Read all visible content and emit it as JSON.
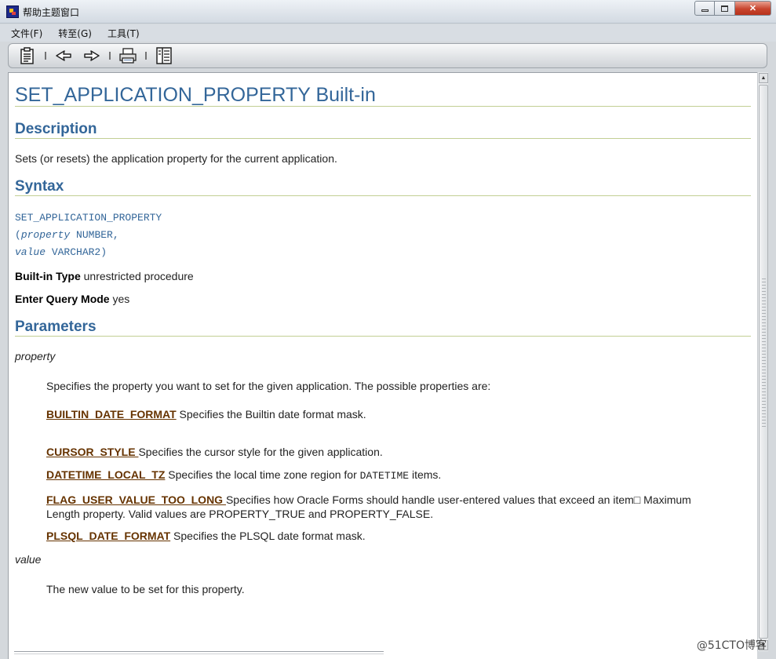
{
  "window": {
    "title": "帮助主题窗口"
  },
  "menu": [
    "文件(F)",
    "转至(G)",
    "工具(T)"
  ],
  "toolbar": {
    "icons": [
      "contents-icon",
      "back-icon",
      "forward-icon",
      "print-icon",
      "index-icon"
    ]
  },
  "doc": {
    "title": "SET_APPLICATION_PROPERTY Built-in",
    "description_heading": "Description",
    "description_text": "Sets (or resets) the application property for the current application.",
    "syntax_heading": "Syntax",
    "syntax_line1": "SET_APPLICATION_PROPERTY",
    "syntax_line2_paren": "(",
    "syntax_line2_param": "property",
    "syntax_line2_type": " NUMBER,",
    "syntax_line3_param": "value",
    "syntax_line3_type": " VARCHAR2)",
    "builtin_type_label": "Built-in Type",
    "builtin_type_value": " unrestricted procedure",
    "enter_query_label": "Enter Query Mode",
    "enter_query_value": " yes",
    "parameters_heading": "Parameters",
    "param1_name": "property",
    "param1_desc": "Specifies the property you want to set for the given application. The possible properties are:",
    "prop1_link": "BUILTIN_DATE_FORMAT",
    "prop1_desc": " Specifies the Builtin date format mask.",
    "prop2_link": "CURSOR_STYLE ",
    "prop2_desc": "Specifies the cursor style for the given application.",
    "prop3_link": "DATETIME_LOCAL_TZ",
    "prop3_desc_a": " Specifies the local time zone region for ",
    "prop3_code": "DATETIME",
    "prop3_desc_b": " items.",
    "prop4_link": "FLAG_USER_VALUE_TOO_LONG ",
    "prop4_desc_line1": "Specifies how Oracle Forms should handle user-entered values that exceed an item□ Maximum",
    "prop4_desc_line2": "Length property. Valid values are PROPERTY_TRUE and PROPERTY_FALSE.",
    "prop5_link": "PLSQL_DATE_FORMAT",
    "prop5_desc": " Specifies the PLSQL date format mask.",
    "param2_name": "value",
    "param2_desc": "The new value to be set for this property."
  },
  "watermark": "@51CTO博客"
}
